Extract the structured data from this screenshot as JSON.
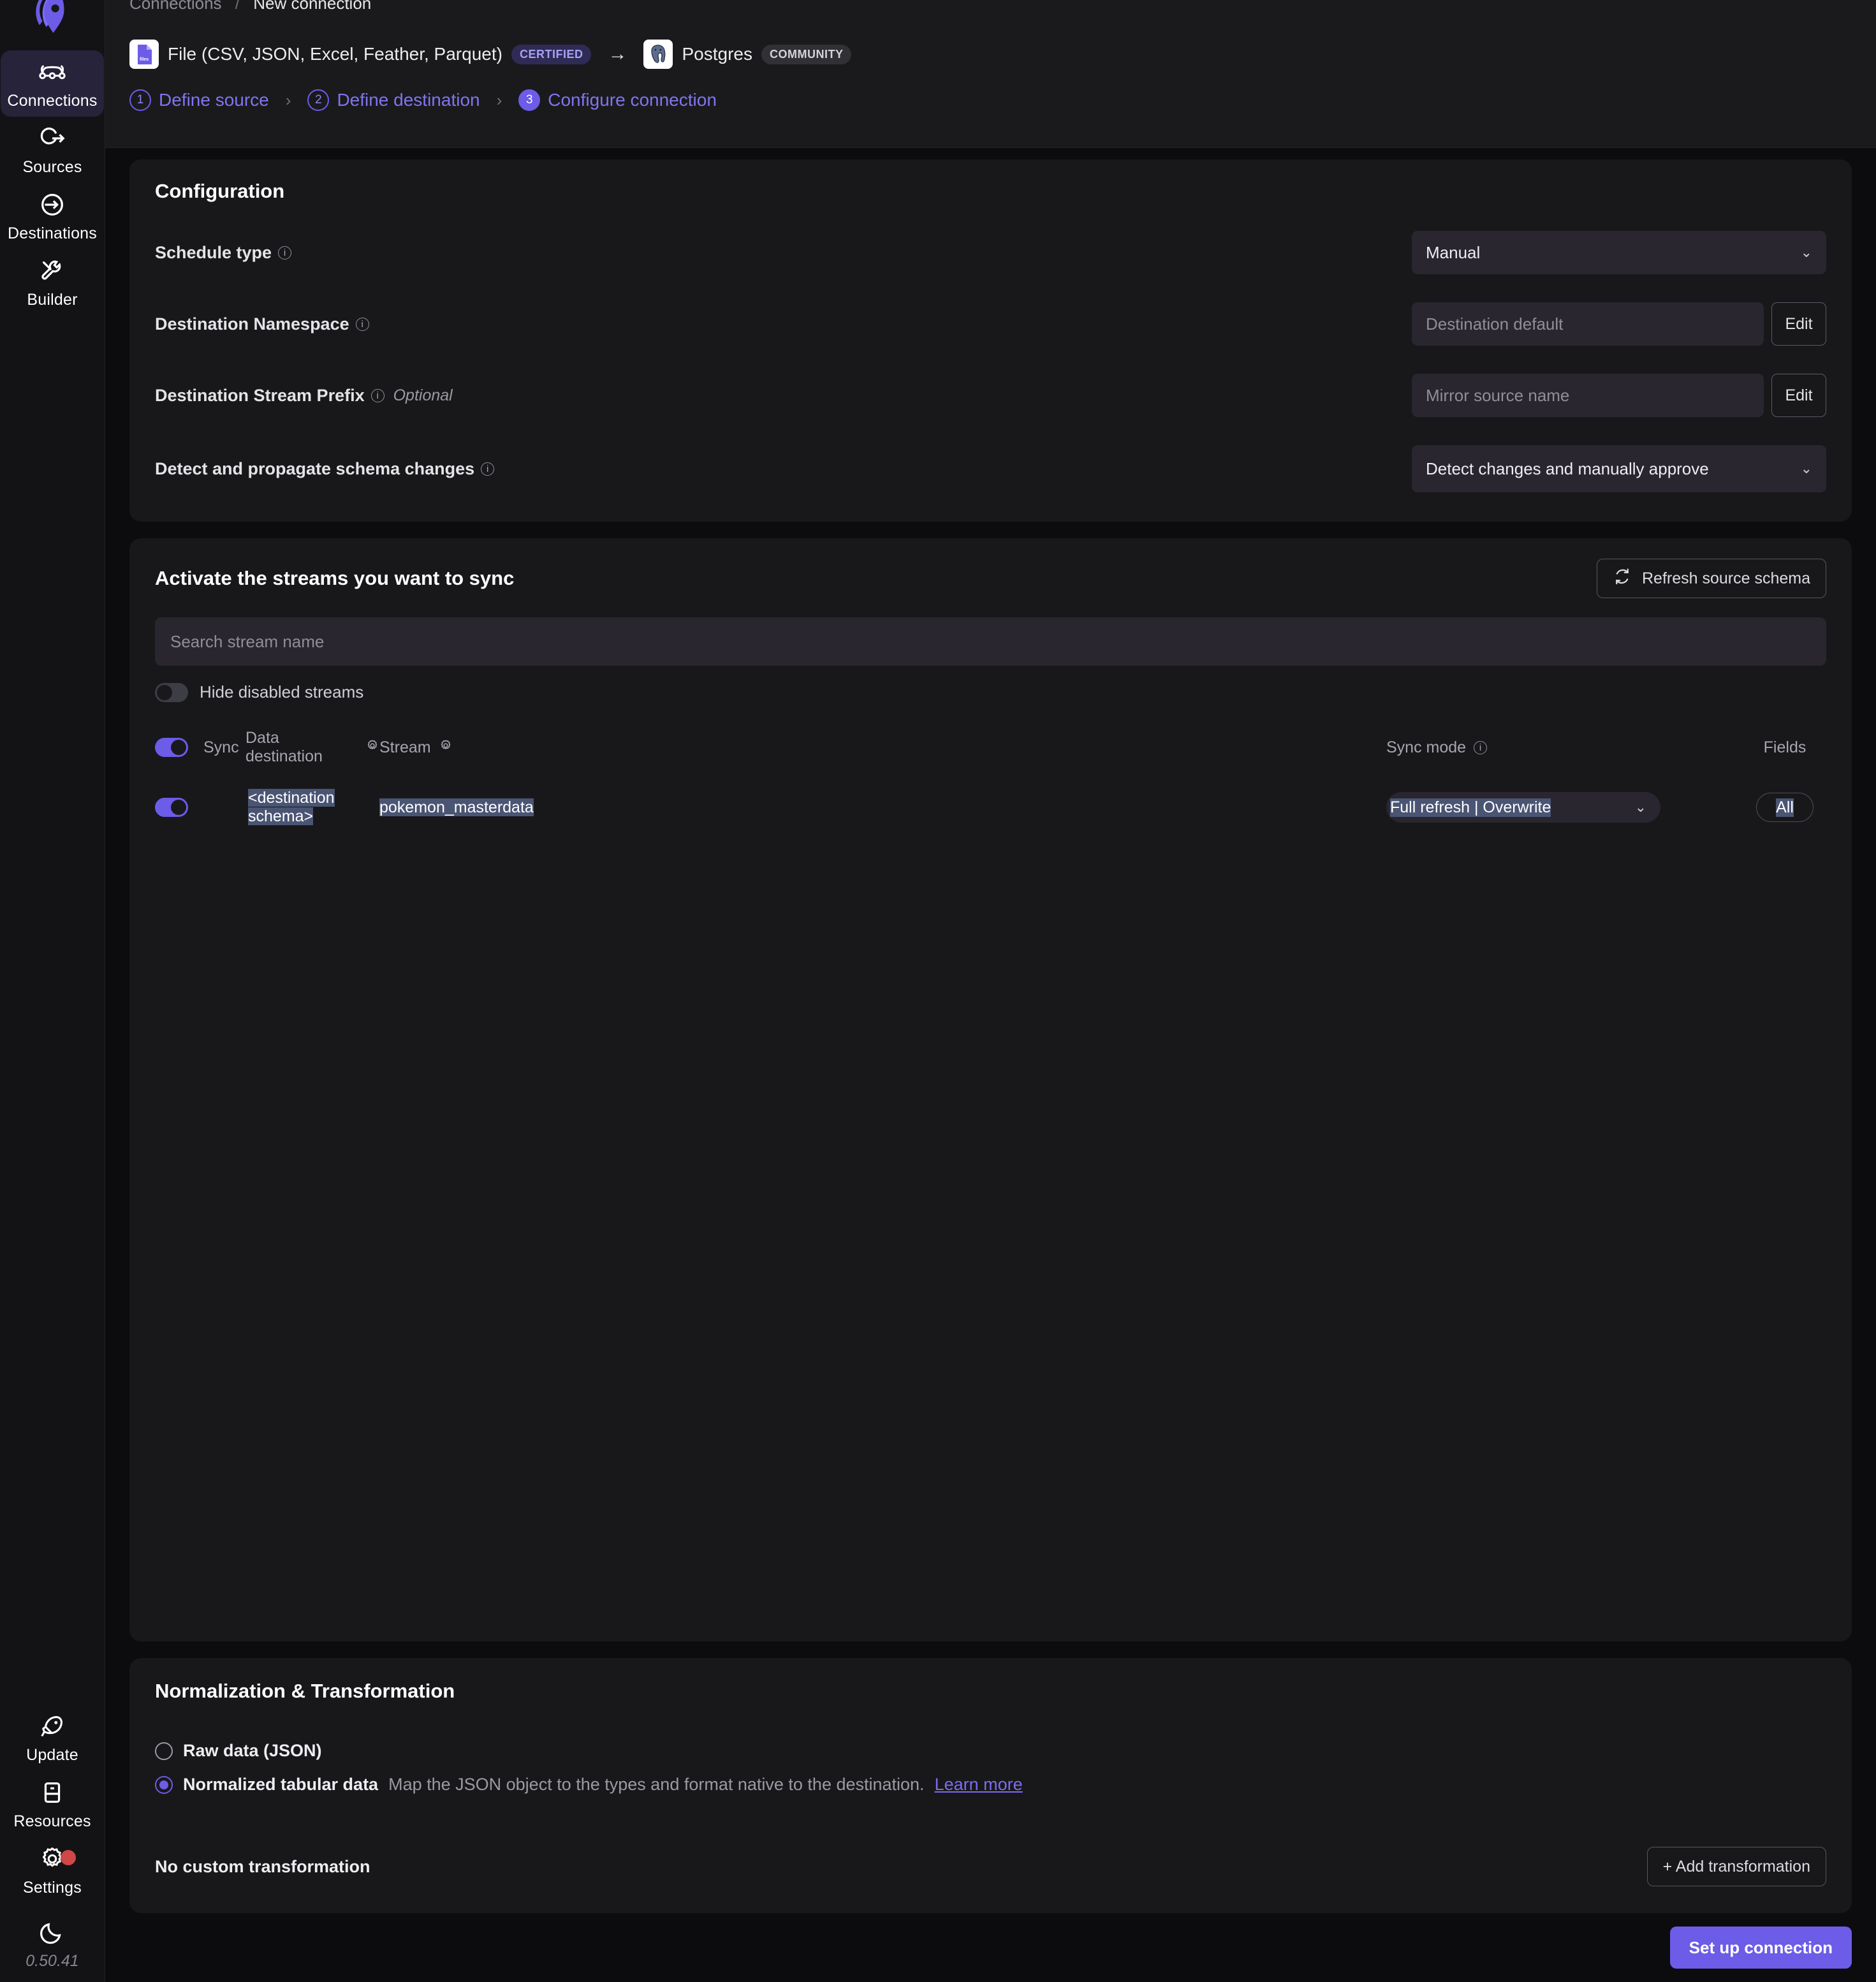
{
  "sidebar": {
    "logo_name": "airbyte-logo",
    "top_items": [
      {
        "label": "Connections",
        "icon": "connections-icon",
        "active": true
      },
      {
        "label": "Sources",
        "icon": "sources-icon",
        "active": false
      },
      {
        "label": "Destinations",
        "icon": "destinations-icon",
        "active": false
      },
      {
        "label": "Builder",
        "icon": "builder-wrench-icon",
        "active": false
      }
    ],
    "bottom_items": [
      {
        "label": "Update",
        "icon": "rocket-icon",
        "badge": false
      },
      {
        "label": "Resources",
        "icon": "book-icon",
        "badge": false
      },
      {
        "label": "Settings",
        "icon": "gear-icon",
        "badge": true
      }
    ],
    "theme_toggle_icon": "moon-icon",
    "version": "0.50.41"
  },
  "breadcrumb": {
    "parent": "Connections",
    "separator": "/",
    "current": "New connection"
  },
  "connector_row": {
    "source": {
      "name": "File (CSV, JSON, Excel, Feather, Parquet)",
      "badge": "CERTIFIED",
      "icon": "file-connector-icon"
    },
    "arrow": "→",
    "destination": {
      "name": "Postgres",
      "badge": "COMMUNITY",
      "icon": "postgres-elephant-icon"
    }
  },
  "steps": [
    {
      "num": "1",
      "label": "Define source",
      "current": false
    },
    {
      "num": "2",
      "label": "Define destination",
      "current": false
    },
    {
      "num": "3",
      "label": "Configure connection",
      "current": true
    }
  ],
  "step_chevron": "›",
  "configuration": {
    "title": "Configuration",
    "rows": [
      {
        "label": "Schedule type",
        "info": true,
        "optional": "",
        "control": "select",
        "value": "Manual"
      },
      {
        "label": "Destination Namespace",
        "info": true,
        "optional": "",
        "control": "input-edit",
        "value": "Destination default",
        "button": "Edit"
      },
      {
        "label": "Destination Stream Prefix",
        "info": true,
        "optional": "Optional",
        "control": "input-edit",
        "value": "Mirror source name",
        "button": "Edit"
      },
      {
        "label": "Detect and propagate schema changes",
        "info": true,
        "optional": "",
        "control": "select",
        "value": "Detect changes and manually approve"
      }
    ]
  },
  "streams": {
    "title": "Activate the streams you want to sync",
    "refresh_button": "Refresh source schema",
    "search_placeholder": "Search stream name",
    "hide_disabled_label": "Hide disabled streams",
    "hide_disabled_on": false,
    "header_toggle_on": true,
    "columns": {
      "sync": "Sync",
      "data_destination": "Data destination",
      "stream": "Stream",
      "sync_mode": "Sync mode",
      "fields": "Fields"
    },
    "rows": [
      {
        "enabled": true,
        "data_destination": "<destination schema>",
        "stream": "pokemon_masterdata",
        "sync_mode": "Full refresh | Overwrite",
        "fields": "All"
      }
    ]
  },
  "normalization": {
    "title": "Normalization & Transformation",
    "options": [
      {
        "label": "Raw data (JSON)",
        "description": "",
        "link": "",
        "checked": false
      },
      {
        "label": "Normalized tabular data",
        "description": "Map the JSON object to the types and format native to the destination.",
        "link": "Learn more",
        "checked": true
      }
    ],
    "footer_text": "No custom transformation",
    "add_button": "+ Add transformation"
  },
  "footer": {
    "primary_button": "Set up connection"
  },
  "colors": {
    "accent": "#6c5ce7",
    "page_bg": "#0c0c0f",
    "card_bg": "#18181b",
    "field_bg": "#29262f",
    "selection": "#4a5573",
    "badge_red": "#cf4747"
  }
}
